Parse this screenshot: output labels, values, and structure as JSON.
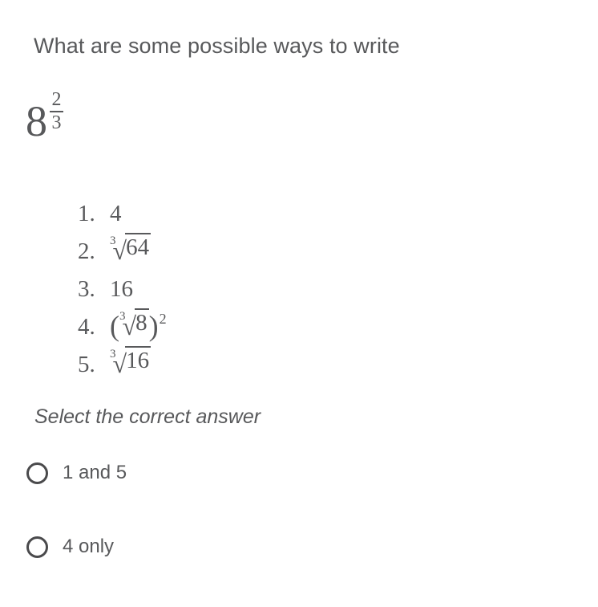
{
  "question": {
    "heading": "What are some possible ways to write",
    "expression": {
      "base": "8",
      "exponent_numerator": "2",
      "exponent_denominator": "3",
      "plain": "8^(2/3)"
    }
  },
  "options": [
    {
      "index": "1.",
      "kind": "plain",
      "text": "4",
      "plain": "4"
    },
    {
      "index": "2.",
      "kind": "radical",
      "root_index": "3",
      "radical_sign": "√",
      "radicand": "64",
      "plain": "cube root of 64"
    },
    {
      "index": "3.",
      "kind": "plain",
      "text": "16",
      "plain": "16"
    },
    {
      "index": "4.",
      "kind": "radical-power",
      "open_paren": "(",
      "root_index": "3",
      "radical_sign": "√",
      "radicand": "8",
      "close_paren": ")",
      "power": "2",
      "plain": "(cube root of 8) squared"
    },
    {
      "index": "5.",
      "kind": "radical",
      "root_index": "3",
      "radical_sign": "√",
      "radicand": "16",
      "plain": "cube root of 16"
    }
  ],
  "instruction": "Select the correct answer",
  "answers": [
    {
      "label": "1 and 5",
      "selected": false
    },
    {
      "label": "4 only",
      "selected": false
    }
  ],
  "colors": {
    "background": "#ffffff",
    "text": "#58595b",
    "radio_stroke": "#4a4a4c"
  }
}
